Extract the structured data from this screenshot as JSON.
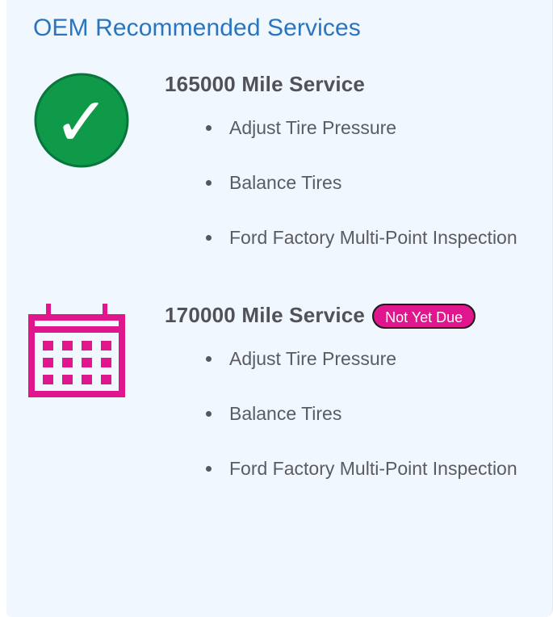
{
  "section": {
    "title": "OEM Recommended Services"
  },
  "colors": {
    "title": "#2a75bf",
    "check_fill": "#0e9a48",
    "check_stroke": "#08763a",
    "calendar": "#e0178c",
    "badge": "#e0178c"
  },
  "services": [
    {
      "name": "165000 Mile Service",
      "icon": "check-circle-icon",
      "status": "completed",
      "tasks": [
        "Adjust Tire Pressure",
        "Balance Tires",
        "Ford Factory Multi-Point Inspection"
      ]
    },
    {
      "name": "170000 Mile Service",
      "icon": "calendar-icon",
      "badge": "Not Yet Due",
      "tasks": [
        "Adjust Tire Pressure",
        "Balance Tires",
        "Ford Factory Multi-Point Inspection"
      ]
    }
  ]
}
